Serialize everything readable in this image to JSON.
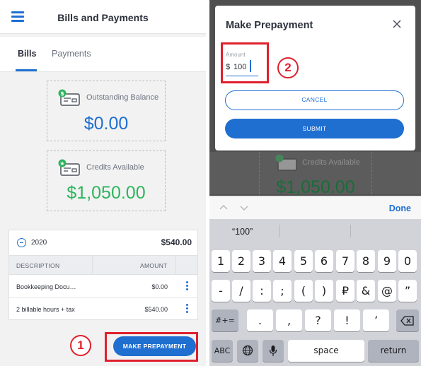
{
  "left": {
    "header": {
      "title": "Bills and Payments",
      "menu_icon": "hamburger-menu-icon"
    },
    "tabs": [
      {
        "label": "Bills",
        "active": true
      },
      {
        "label": "Payments",
        "active": false
      }
    ],
    "outstanding": {
      "label": "Outstanding Balance",
      "value": "$0.00",
      "color": "#1f6fd1"
    },
    "credits": {
      "label": "Credits Available",
      "value": "$1,050.00",
      "color": "#2db55d"
    },
    "table": {
      "year": "2020",
      "total": "$540.00",
      "columns": [
        "DESCRIPTION",
        "AMOUNT"
      ],
      "rows": [
        {
          "description": "Bookkeeping Docu…",
          "amount": "$0.00"
        },
        {
          "description": "2 billable hours + tax",
          "amount": "$540.00"
        }
      ]
    },
    "prepay_button": "MAKE PREPAYMENT",
    "annotation": "1"
  },
  "right": {
    "background": {
      "label": "Credits Available",
      "value": "$1,050.00"
    },
    "modal": {
      "title": "Make Prepayment",
      "field_label": "Amount",
      "currency": "$",
      "value": "100",
      "cancel": "CANCEL",
      "submit": "SUBMIT",
      "annotation": "2"
    },
    "keyboard": {
      "done": "Done",
      "suggestion": "“100”",
      "row1": [
        "1",
        "2",
        "3",
        "4",
        "5",
        "6",
        "7",
        "8",
        "9",
        "0"
      ],
      "row2": [
        "-",
        "/",
        ":",
        ";",
        "(",
        ")",
        "₽",
        "&",
        "@",
        "”"
      ],
      "row3_left": "#+=",
      "row3": [
        ".",
        ",",
        "?",
        "!",
        "’"
      ],
      "row4": {
        "abc": "ABC",
        "space": "space",
        "return": "return"
      }
    }
  },
  "colors": {
    "accent": "#1f6fd1",
    "green": "#2db55d",
    "annotation": "#e0202c"
  }
}
